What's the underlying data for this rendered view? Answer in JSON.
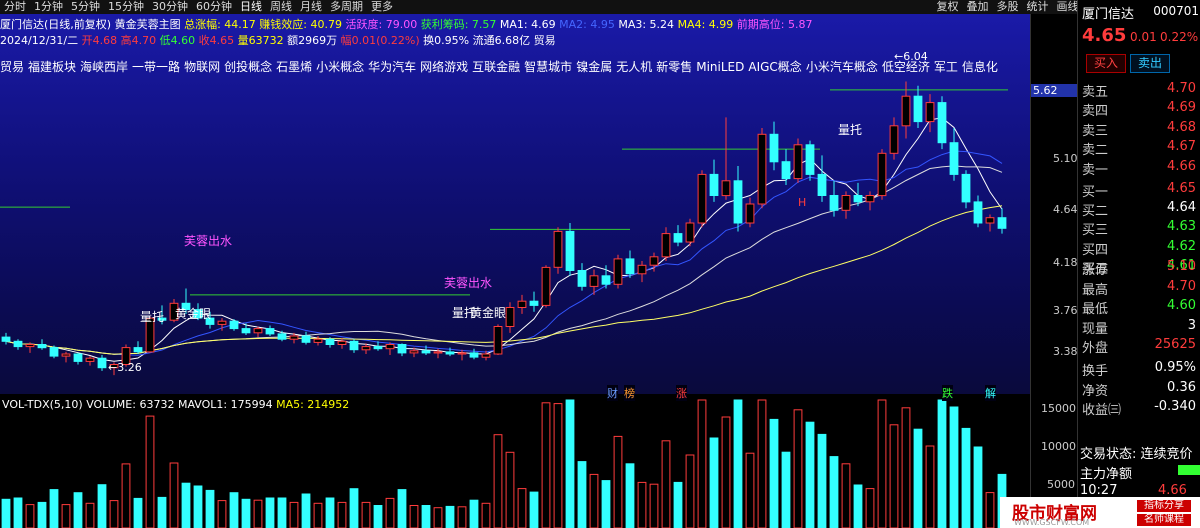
{
  "topbar": {
    "periods": [
      "分时",
      "1分钟",
      "5分钟",
      "15分钟",
      "30分钟",
      "60分钟",
      "日线",
      "周线",
      "月线",
      "多周期",
      "更多"
    ],
    "active": "日线",
    "tools": [
      "复权",
      "叠加",
      "多股",
      "统计",
      "画线",
      "F10",
      "标记",
      "-",
      "+",
      "返回"
    ]
  },
  "info1": {
    "name": "厦门信达(日线,前复权)",
    "indicator": "黄金芙蓉主图",
    "zhangfu": "总涨幅: 44.17",
    "zhuanqian": "赚钱效应: 40.79",
    "huoyue": "活跃度: 79.00",
    "huoli": "获利筹码: 7.57",
    "ma1": "MA1: 4.69",
    "ma2": "MA2: 4.95",
    "ma3": "MA3: 5.24",
    "ma4": "MA4: 4.99",
    "qianji": "前期高位: 5.87"
  },
  "info2": {
    "date": "2024/12/31/二",
    "open": "开4.68",
    "high": "高4.70",
    "low": "低4.60",
    "close": "收4.65",
    "vol": "量63732",
    "amount": "额2969万",
    "change": "幅0.01(0.22%)",
    "turnover": "换0.95%",
    "float": "流通6.68亿",
    "trade": "贸易"
  },
  "tags": [
    "贸易",
    "福建板块",
    "海峡西岸",
    "一带一路",
    "物联网",
    "创投概念",
    "石墨烯",
    "小米概念",
    "华为汽车",
    "网络游戏",
    "互联金融",
    "智慧城市",
    "镍金属",
    "无人机",
    "新零售",
    "MiniLED",
    "AIGC概念",
    "小米汽车概念",
    "低空经济",
    "军工",
    "信息化"
  ],
  "annotations": {
    "furong": "芙蓉出水",
    "furong2": "芙蓉出水",
    "liangtuo1": "量托",
    "liangtuo2": "量托",
    "liangtuo3": "量托",
    "jinyan1": "黄金眼",
    "jinyan2": "黄金眼",
    "low": "3.26",
    "high": "6.04",
    "h": "H",
    "events": [
      "财",
      "榜",
      "涨",
      "跌",
      "解"
    ]
  },
  "axis": {
    "price": [
      "5.62",
      "5.10",
      "4.64",
      "4.18",
      "3.76",
      "3.38"
    ],
    "vol": [
      "15000",
      "10000",
      "5000"
    ]
  },
  "vol_info": {
    "name": "VOL-TDX(5,10)",
    "volume": "VOLUME: 63732",
    "mavol1": "MAVOL1: 175994",
    "ma5": "MA5: 214952"
  },
  "right_panel": {
    "title": "厦门信达",
    "code": "000701",
    "price": "4.65",
    "chg": "0.01",
    "pct": "0.22%",
    "buy_label": "买入",
    "sell_label": "卖出",
    "asks": [
      [
        "卖五",
        "4.70"
      ],
      [
        "卖四",
        "4.69"
      ],
      [
        "卖三",
        "4.68"
      ],
      [
        "卖二",
        "4.67"
      ],
      [
        "卖一",
        "4.66"
      ]
    ],
    "bids": [
      [
        "买一",
        "4.65"
      ],
      [
        "买二",
        "4.64"
      ],
      [
        "买三",
        "4.63"
      ],
      [
        "买四",
        "4.62"
      ],
      [
        "买五",
        "4.61"
      ]
    ],
    "stats": [
      [
        "涨停",
        "5.10"
      ],
      [
        "最高",
        "4.70"
      ],
      [
        "最低",
        "4.60"
      ],
      [
        "现量",
        "3"
      ],
      [
        "外盘",
        "25625"
      ],
      [
        "换手",
        "0.95%"
      ],
      [
        "净资",
        "0.36"
      ],
      [
        "收益㈢",
        "-0.340"
      ]
    ],
    "status_label": "交易状态: 连续竞价",
    "zhuli": "主力净额",
    "time": "10:27",
    "time_price": "4.66"
  },
  "watermark": {
    "big": "股市财富网",
    "small": "WWW.GSCFW.COM",
    "b1": "指标分享",
    "b2": "名师课程"
  },
  "chart_data": {
    "type": "candlestick",
    "candles": [
      [
        3.62,
        3.66,
        3.55,
        3.58
      ],
      [
        3.58,
        3.6,
        3.5,
        3.53
      ],
      [
        3.53,
        3.57,
        3.47,
        3.55
      ],
      [
        3.55,
        3.6,
        3.5,
        3.52
      ],
      [
        3.52,
        3.54,
        3.42,
        3.44
      ],
      [
        3.44,
        3.48,
        3.38,
        3.46
      ],
      [
        3.46,
        3.47,
        3.36,
        3.39
      ],
      [
        3.39,
        3.44,
        3.35,
        3.42
      ],
      [
        3.42,
        3.45,
        3.3,
        3.33
      ],
      [
        3.33,
        3.38,
        3.26,
        3.36
      ],
      [
        3.36,
        3.55,
        3.34,
        3.52
      ],
      [
        3.52,
        3.58,
        3.46,
        3.48
      ],
      [
        3.48,
        3.82,
        3.47,
        3.8
      ],
      [
        3.8,
        3.92,
        3.74,
        3.78
      ],
      [
        3.78,
        3.98,
        3.76,
        3.94
      ],
      [
        3.94,
        4.08,
        3.84,
        3.88
      ],
      [
        3.88,
        3.94,
        3.78,
        3.8
      ],
      [
        3.8,
        3.86,
        3.7,
        3.74
      ],
      [
        3.74,
        3.8,
        3.68,
        3.77
      ],
      [
        3.77,
        3.79,
        3.68,
        3.7
      ],
      [
        3.7,
        3.75,
        3.64,
        3.66
      ],
      [
        3.66,
        3.72,
        3.62,
        3.7
      ],
      [
        3.7,
        3.73,
        3.63,
        3.65
      ],
      [
        3.65,
        3.68,
        3.58,
        3.6
      ],
      [
        3.6,
        3.66,
        3.56,
        3.63
      ],
      [
        3.63,
        3.67,
        3.55,
        3.57
      ],
      [
        3.57,
        3.63,
        3.54,
        3.6
      ],
      [
        3.6,
        3.62,
        3.52,
        3.55
      ],
      [
        3.55,
        3.61,
        3.51,
        3.58
      ],
      [
        3.58,
        3.6,
        3.47,
        3.5
      ],
      [
        3.5,
        3.56,
        3.46,
        3.53
      ],
      [
        3.53,
        3.58,
        3.49,
        3.51
      ],
      [
        3.51,
        3.57,
        3.45,
        3.55
      ],
      [
        3.55,
        3.56,
        3.44,
        3.47
      ],
      [
        3.47,
        3.52,
        3.43,
        3.49
      ],
      [
        3.49,
        3.54,
        3.45,
        3.47
      ],
      [
        3.47,
        3.51,
        3.42,
        3.48
      ],
      [
        3.48,
        3.52,
        3.44,
        3.46
      ],
      [
        3.46,
        3.5,
        3.4,
        3.47
      ],
      [
        3.47,
        3.51,
        3.41,
        3.43
      ],
      [
        3.43,
        3.49,
        3.4,
        3.46
      ],
      [
        3.46,
        3.74,
        3.45,
        3.72
      ],
      [
        3.72,
        3.95,
        3.66,
        3.9
      ],
      [
        3.9,
        4.02,
        3.84,
        3.96
      ],
      [
        3.96,
        4.05,
        3.86,
        3.92
      ],
      [
        3.92,
        4.3,
        3.9,
        4.28
      ],
      [
        4.28,
        4.66,
        4.22,
        4.62
      ],
      [
        4.62,
        4.7,
        4.2,
        4.25
      ],
      [
        4.25,
        4.32,
        4.06,
        4.1
      ],
      [
        4.1,
        4.26,
        4.02,
        4.2
      ],
      [
        4.2,
        4.3,
        4.08,
        4.12
      ],
      [
        4.12,
        4.4,
        4.08,
        4.36
      ],
      [
        4.36,
        4.44,
        4.18,
        4.22
      ],
      [
        4.22,
        4.34,
        4.14,
        4.3
      ],
      [
        4.3,
        4.42,
        4.24,
        4.38
      ],
      [
        4.38,
        4.66,
        4.34,
        4.6
      ],
      [
        4.6,
        4.68,
        4.48,
        4.52
      ],
      [
        4.52,
        4.74,
        4.48,
        4.7
      ],
      [
        4.7,
        5.2,
        4.66,
        5.16
      ],
      [
        5.16,
        5.3,
        4.9,
        4.96
      ],
      [
        4.96,
        5.7,
        4.92,
        5.1
      ],
      [
        5.1,
        5.24,
        4.62,
        4.7
      ],
      [
        4.7,
        4.94,
        4.66,
        4.88
      ],
      [
        4.88,
        5.6,
        4.84,
        5.54
      ],
      [
        5.54,
        5.66,
        5.2,
        5.28
      ],
      [
        5.28,
        5.4,
        5.06,
        5.12
      ],
      [
        5.12,
        5.5,
        5.08,
        5.44
      ],
      [
        5.44,
        5.48,
        5.1,
        5.16
      ],
      [
        5.16,
        5.34,
        4.9,
        4.96
      ],
      [
        4.96,
        5.1,
        4.76,
        4.82
      ],
      [
        4.82,
        5.0,
        4.74,
        4.96
      ],
      [
        4.96,
        5.08,
        4.86,
        4.9
      ],
      [
        4.9,
        5.0,
        4.82,
        4.96
      ],
      [
        4.96,
        5.4,
        4.92,
        5.36
      ],
      [
        5.36,
        5.7,
        5.3,
        5.62
      ],
      [
        5.62,
        6.04,
        5.5,
        5.9
      ],
      [
        5.9,
        6.0,
        5.6,
        5.66
      ],
      [
        5.66,
        5.92,
        5.56,
        5.84
      ],
      [
        5.84,
        5.9,
        5.4,
        5.46
      ],
      [
        5.46,
        5.6,
        5.1,
        5.16
      ],
      [
        5.16,
        5.2,
        4.84,
        4.9
      ],
      [
        4.9,
        4.96,
        4.66,
        4.7
      ],
      [
        4.7,
        4.78,
        4.62,
        4.75
      ],
      [
        4.75,
        4.84,
        4.6,
        4.65
      ]
    ]
  }
}
